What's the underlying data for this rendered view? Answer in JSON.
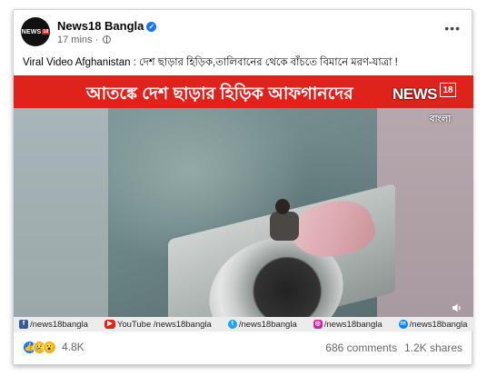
{
  "post": {
    "page_name": "News18 Bangla",
    "time": "17 mins",
    "avatar_text": "NEWS",
    "avatar_badge": "18",
    "caption": "Viral Video Afghanistan : দেশ ছাড়ার হিড়িক,তালিবানের থেকে বাঁচতে বিমানে মরণ-যাত্রা !",
    "more": "•••"
  },
  "media": {
    "banner_text": "আতঙ্কে দেশ ছাড়ার হিড়িক আফগানদের",
    "logo_word": "NEWS",
    "logo_number": "18",
    "logo_sub": "বাংলা",
    "banner_color": "#e0221d",
    "social": [
      {
        "icon": "facebook-icon",
        "label": "/news18bangla"
      },
      {
        "icon": "youtube-icon",
        "label": "YouTube /news18bangla"
      },
      {
        "icon": "twitter-icon",
        "label": "/news18bangla"
      },
      {
        "icon": "instagram-icon",
        "label": "/news18bangla"
      },
      {
        "icon": "messenger-icon",
        "label": "/news18bangla"
      }
    ]
  },
  "footer": {
    "reaction_count": "4.8K",
    "comments": "686 comments",
    "shares": "1.2K shares"
  },
  "colors": {
    "accent": "#1877f2",
    "meta_text": "#65676b"
  }
}
